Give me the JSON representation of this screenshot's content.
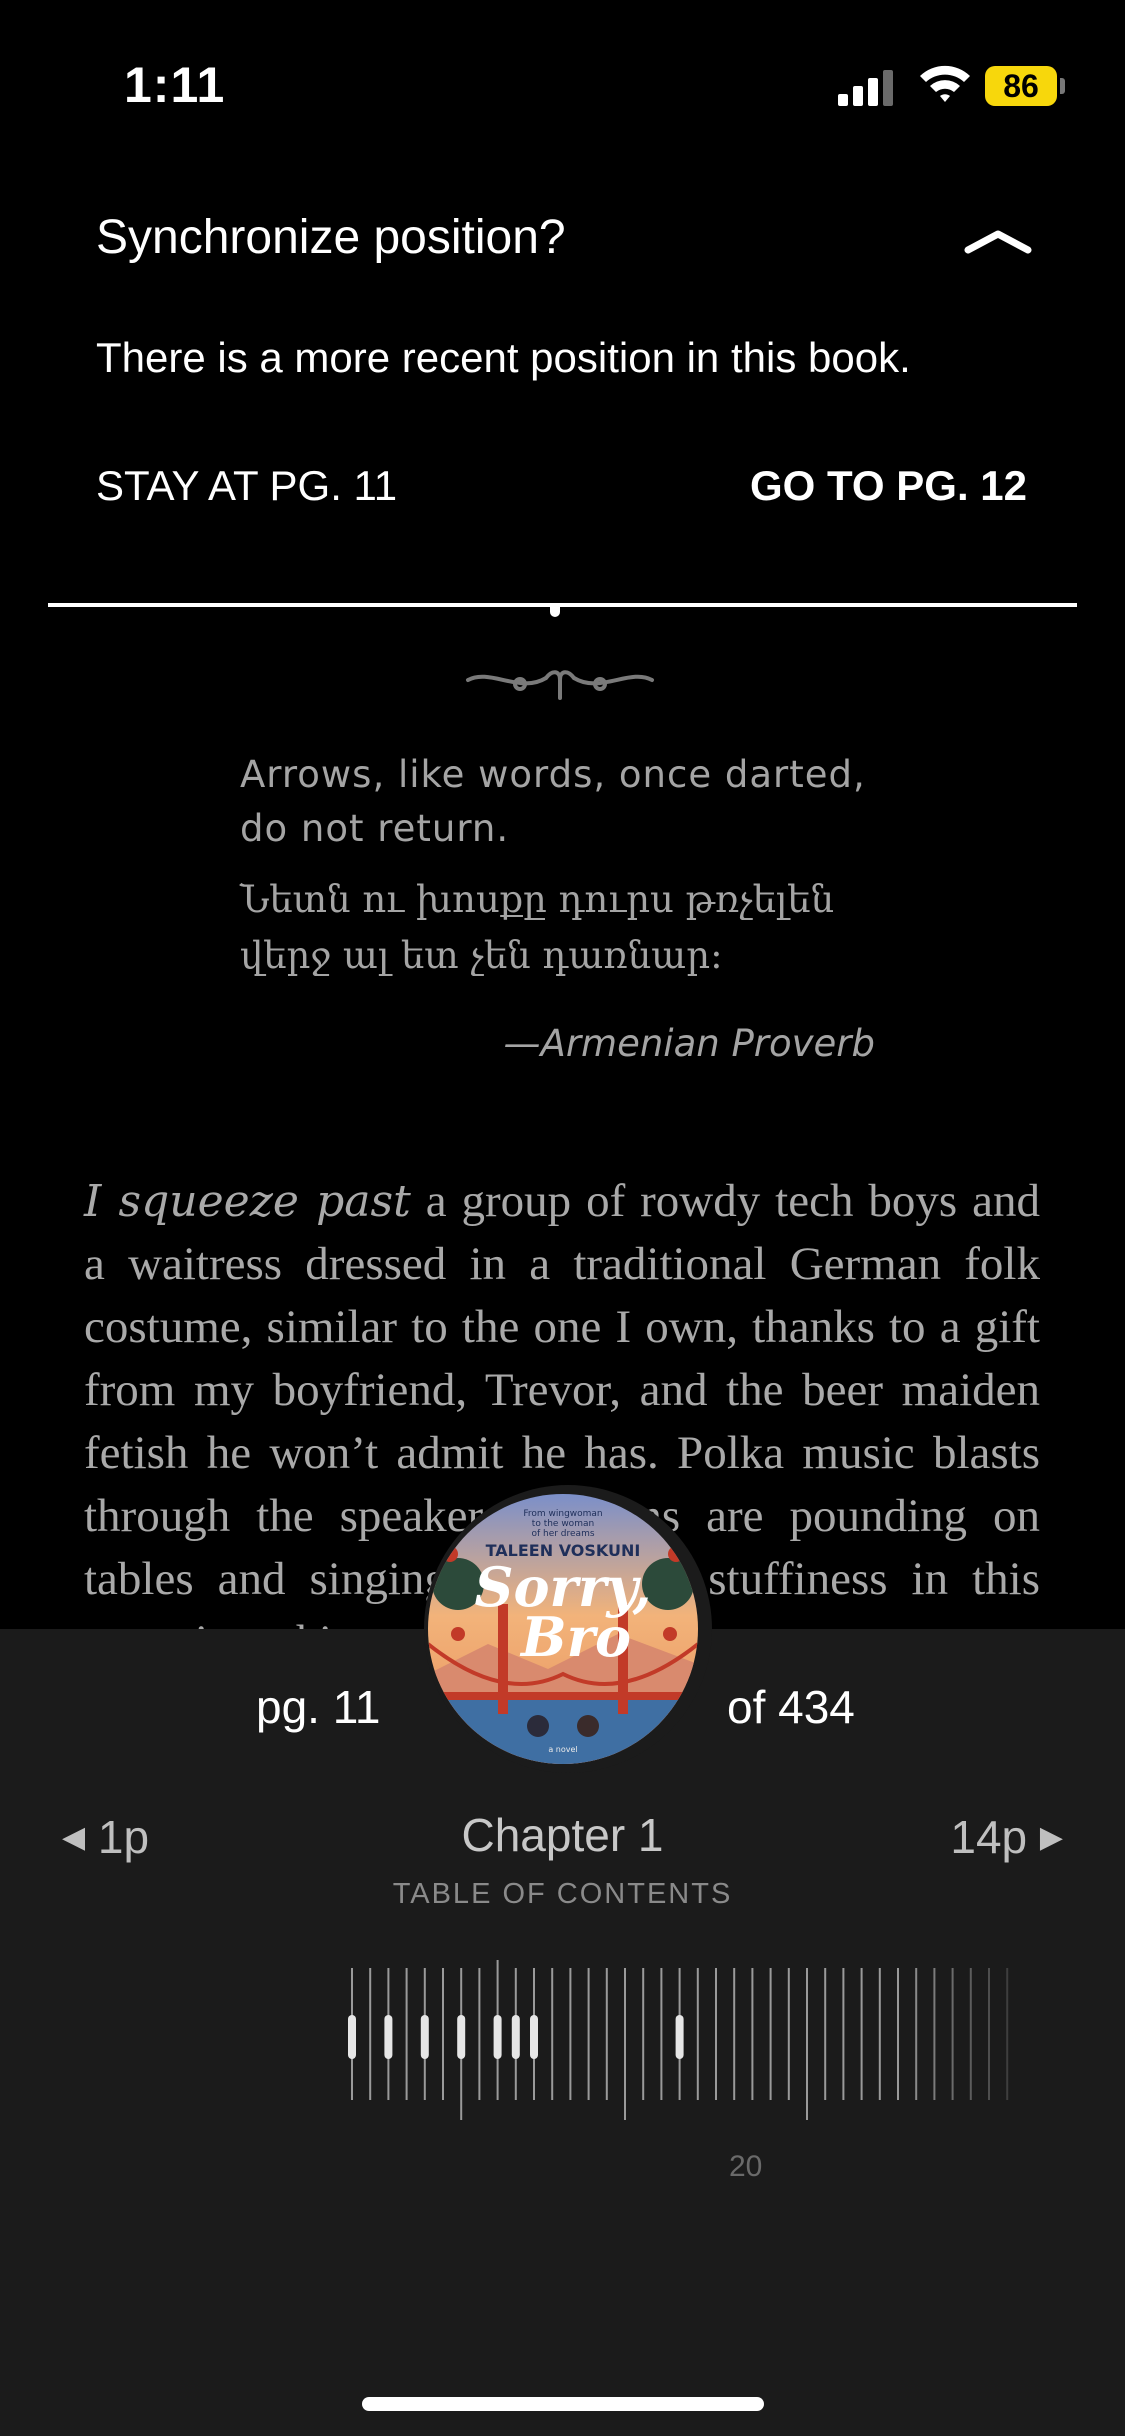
{
  "status_bar": {
    "time": "1:11",
    "battery": "86"
  },
  "sync_banner": {
    "title": "Synchronize position?",
    "message": "There is a more recent position in this book.",
    "stay_label": "STAY AT PG. 11",
    "go_label": "GO TO PG. 12"
  },
  "epigraph": {
    "english": "Arrows, like words, once darted, do not return.",
    "armenian": "Նետն ու խոսքը դուրս թռչելեն վերջ ալ ետ չեն դառնար:",
    "attribution": "—Armenian Proverb"
  },
  "body": {
    "lead": "I squeeze past",
    "text": " a group of rowdy tech boys and a waitress dressed in a traditional German folk costume, similar to the one I own, thanks to a gift from my boyfriend, Trevor, and the beer maiden fetish he won’t admit he has. Polka music blasts through the speakers. Patrons are pounding on tables and singing along. The stuffiness in this room is making me sweat"
  },
  "navigator": {
    "page_label": "pg. 11",
    "total_label": "of 434",
    "prev_label": "1p",
    "next_label": "14p",
    "chapter": "Chapter 1",
    "toc_label": "TABLE OF CONTENTS",
    "scrubber_label": "20"
  },
  "cover": {
    "tagline": "From wingwoman to the woman of her dreams",
    "author": "TALEEN VOSKUNI",
    "title_line1": "Sorry,",
    "title_line2": "Bro",
    "subtitle": "a novel"
  },
  "colors": {
    "accent_battery": "#f7d70c",
    "panel": "#1b1b1b"
  }
}
